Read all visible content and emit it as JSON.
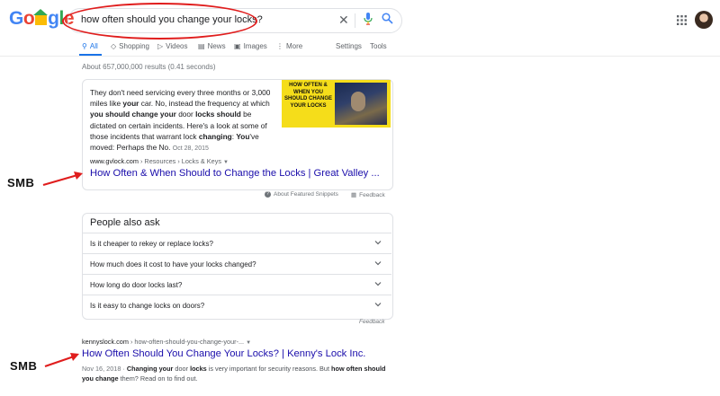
{
  "logo": {
    "text": "Google"
  },
  "search": {
    "query": "how often should you change your locks?"
  },
  "tabs": [
    {
      "label": "All",
      "icon": "search-icon",
      "active": true
    },
    {
      "label": "Shopping",
      "icon": "tag-icon"
    },
    {
      "label": "Videos",
      "icon": "play-icon"
    },
    {
      "label": "News",
      "icon": "news-icon"
    },
    {
      "label": "Images",
      "icon": "image-icon"
    },
    {
      "label": "More",
      "icon": "more-vertical-icon"
    },
    {
      "label": "Settings"
    },
    {
      "label": "Tools"
    }
  ],
  "stats": "About 657,000,000 results (0.41 seconds)",
  "featured": {
    "text_parts": [
      [
        "They don't need servicing every three months or 3,000 miles like ",
        false
      ],
      [
        "your",
        true
      ],
      [
        " car. No, instead the frequency at which ",
        false
      ],
      [
        "you should change your",
        true
      ],
      [
        " door ",
        false
      ],
      [
        "locks should",
        true
      ],
      [
        " be dictated on certain incidents. Here's a look at some of those incidents that warrant lock ",
        false
      ],
      [
        "changing",
        true
      ],
      [
        ": ",
        false
      ],
      [
        "You",
        true
      ],
      [
        "'ve moved: Perhaps the No.",
        false
      ]
    ],
    "date": "Oct 28, 2015",
    "thumb_text": "How Often & When You Should Change Your Locks",
    "cite_domain": "www.gvlock.com",
    "cite_path": " › Resources › Locks & Keys",
    "title": "How Often & When Should to Change the Locks | Great Valley ...",
    "about_label": "About Featured Snippets",
    "feedback_label": "Feedback"
  },
  "annotation_label": "SMB",
  "paa": {
    "title": "People also ask",
    "questions": [
      "Is it cheaper to rekey or replace locks?",
      "How much does it cost to have your locks changed?",
      "How long do door locks last?",
      "Is it easy to change locks on doors?"
    ],
    "feedback_label": "Feedback"
  },
  "result2": {
    "cite_domain": "kennyslock.com",
    "cite_path": " › how-often-should-you-change-your-...",
    "title": "How Often Should You Change Your Locks? | Kenny's Lock Inc.",
    "date": "Nov 16, 2018",
    "snippet_parts": [
      [
        "Nov 16, 2018 · ",
        false
      ],
      [
        "Changing your",
        true
      ],
      [
        " door ",
        false
      ],
      [
        "locks",
        true
      ],
      [
        " is very important for security reasons. But ",
        false
      ],
      [
        "how often should you change",
        true
      ],
      [
        " them? Read on to find out.",
        false
      ]
    ]
  },
  "colors": {
    "link": "#1a0dab",
    "accent": "#1a73e8",
    "annotation_red": "#e01d1d"
  }
}
